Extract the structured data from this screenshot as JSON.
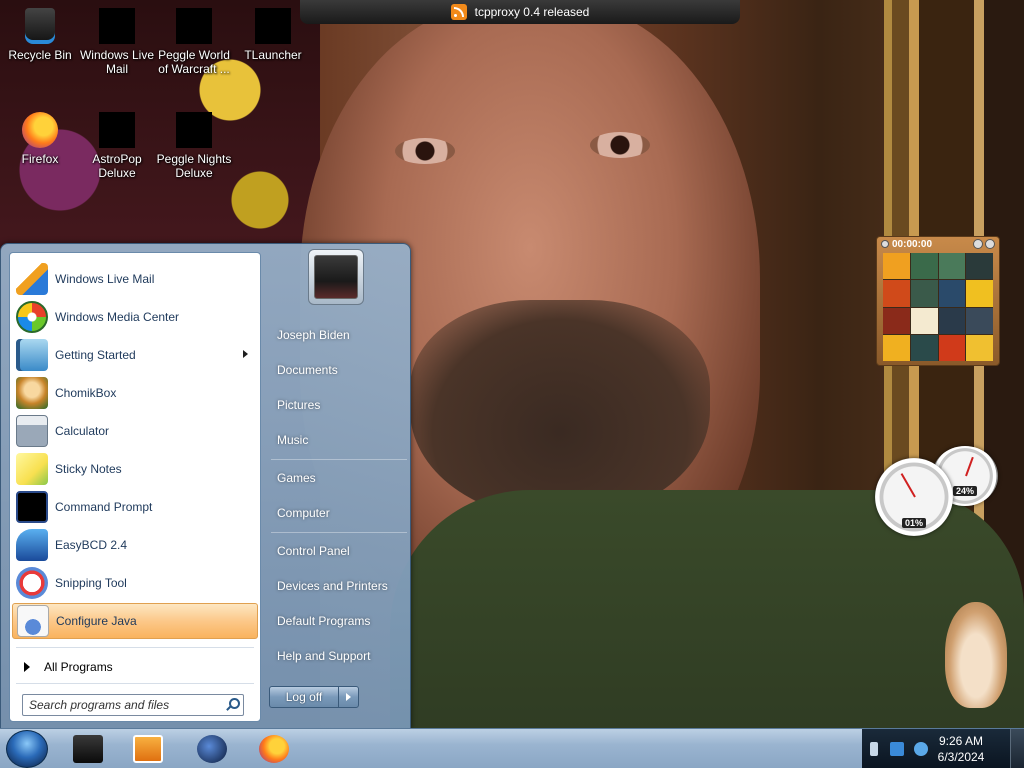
{
  "notification": {
    "text": "tcpproxy 0.4 released",
    "icon": "rss-icon"
  },
  "desktop_icons": [
    {
      "label": "Recycle Bin",
      "icon": "recycle-bin-icon"
    },
    {
      "label": "Windows Live Mail",
      "icon": "mail-icon"
    },
    {
      "label": "Peggle World of Warcraft ...",
      "icon": "game-icon"
    },
    {
      "label": "TLauncher",
      "icon": "game-icon"
    },
    {
      "label": "Firefox",
      "icon": "firefox-icon"
    },
    {
      "label": "AstroPop Deluxe",
      "icon": "game-icon"
    },
    {
      "label": "Peggle Nights Deluxe",
      "icon": "game-icon"
    }
  ],
  "start_menu": {
    "programs": [
      {
        "label": "Windows Live Mail",
        "icon": "mail-icon"
      },
      {
        "label": "Windows Media Center",
        "icon": "media-center-icon"
      },
      {
        "label": "Getting Started",
        "icon": "getting-started-icon",
        "has_submenu": true
      },
      {
        "label": "ChomikBox",
        "icon": "chomikbox-icon"
      },
      {
        "label": "Calculator",
        "icon": "calculator-icon"
      },
      {
        "label": "Sticky Notes",
        "icon": "sticky-notes-icon"
      },
      {
        "label": "Command Prompt",
        "icon": "command-prompt-icon"
      },
      {
        "label": "EasyBCD 2.4",
        "icon": "easybcd-icon"
      },
      {
        "label": "Snipping Tool",
        "icon": "snipping-tool-icon"
      },
      {
        "label": "Configure Java",
        "icon": "java-icon",
        "highlighted": true
      }
    ],
    "all_programs": "All Programs",
    "search_placeholder": "Search programs and files",
    "places": [
      "Joseph Biden",
      "Documents",
      "Pictures",
      "Music",
      "Games",
      "Computer",
      "Control Panel",
      "Devices and Printers",
      "Default Programs",
      "Help and Support"
    ],
    "logoff_label": "Log off"
  },
  "gadgets": {
    "puzzle_timer": "00:00:00",
    "cpu_percent": "01%",
    "memory_percent": "24%"
  },
  "taskbar": {
    "apps": [
      {
        "icon": "cube-app-icon"
      },
      {
        "icon": "media-player-icon"
      },
      {
        "icon": "globe-app-icon"
      },
      {
        "icon": "firefox-icon"
      }
    ],
    "clock_time": "9:26 AM",
    "clock_date": "6/3/2024"
  },
  "colors": {
    "menu_text": "#1e395b",
    "highlight": "#fcc889",
    "taskbar": "#9ab4d0",
    "tray": "#0a1420"
  }
}
